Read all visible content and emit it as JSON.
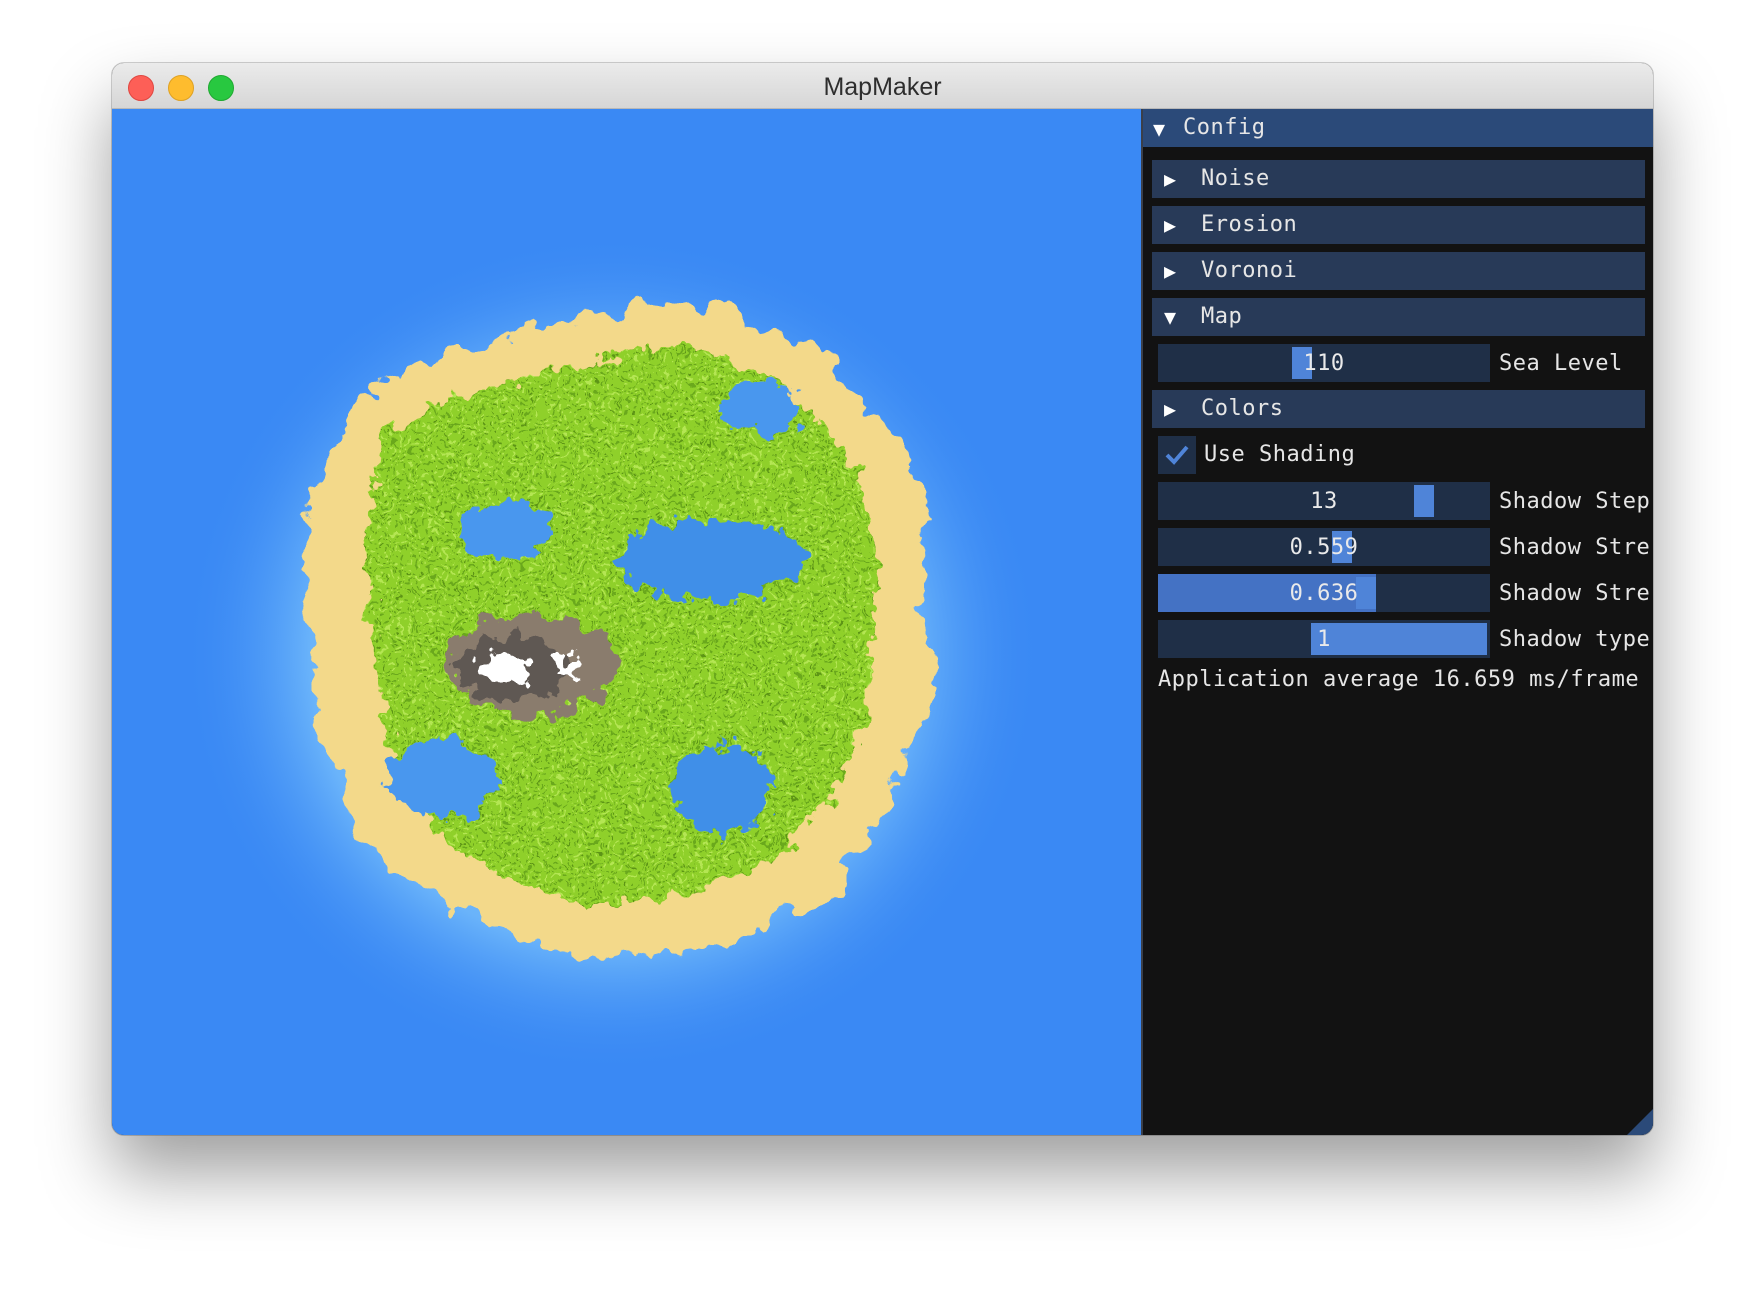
{
  "window": {
    "title": "MapMaker"
  },
  "panel": {
    "config_header": "Config",
    "sections": {
      "noise": "Noise",
      "erosion": "Erosion",
      "voronoi": "Voronoi",
      "map": "Map",
      "colors": "Colors"
    },
    "sea_level": {
      "value": "110",
      "label": "Sea Level",
      "fraction": 0.43
    },
    "use_shading": {
      "label": "Use Shading",
      "checked": true
    },
    "shadow_steps": {
      "value": "13",
      "label": "Shadow Step",
      "fraction": 0.82
    },
    "shadow_strength_1": {
      "value": "0.559",
      "label": "Shadow Stre",
      "fraction": 0.559
    },
    "shadow_strength_2": {
      "value": "0.636",
      "label": "Shadow Stre",
      "fraction": 0.636
    },
    "shadow_type": {
      "value": "1",
      "label": "Shadow type",
      "fraction": 1.0
    },
    "status": "Application average 16.659 ms/frame"
  },
  "colors": {
    "ocean": "#3a89f4",
    "panel_bg": "#121212",
    "header_bg": "#2b4a79",
    "section_bg": "#283a58",
    "slider_bg": "#1f2f47",
    "accent": "#4f84d8",
    "sand": "#f5dc8c",
    "grass": "#92d22e",
    "rock": "#8a7b6d",
    "snow": "#ffffff"
  }
}
